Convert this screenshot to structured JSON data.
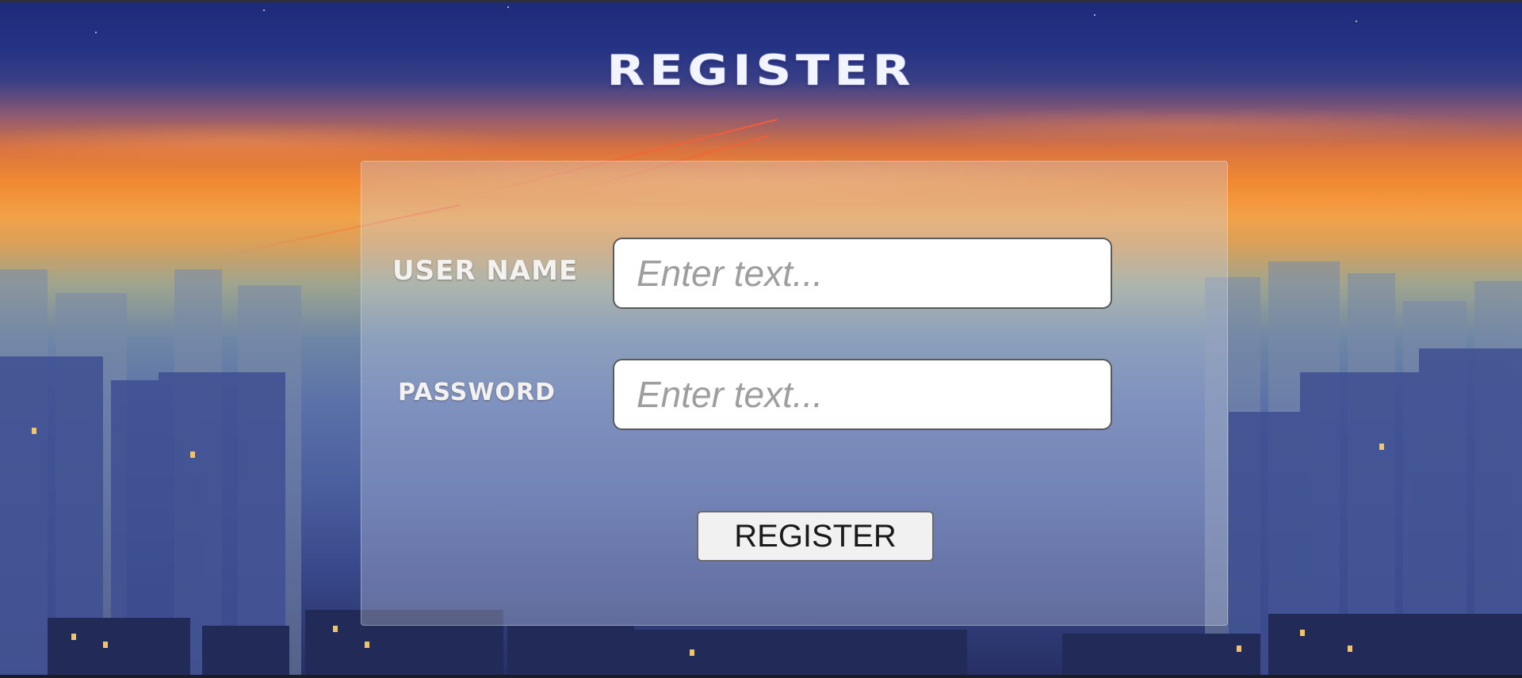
{
  "page": {
    "title": "REGISTER"
  },
  "form": {
    "username_label": "USER NAME",
    "username_placeholder": "Enter text...",
    "password_label": "PASSWORD",
    "password_placeholder": "Enter text...",
    "submit_label": "REGISTER"
  },
  "colors": {
    "sky_top": "#1c2a78",
    "sunset": "#f08a32",
    "city": "#4a5e9e",
    "panel": "#cdd7eb"
  }
}
